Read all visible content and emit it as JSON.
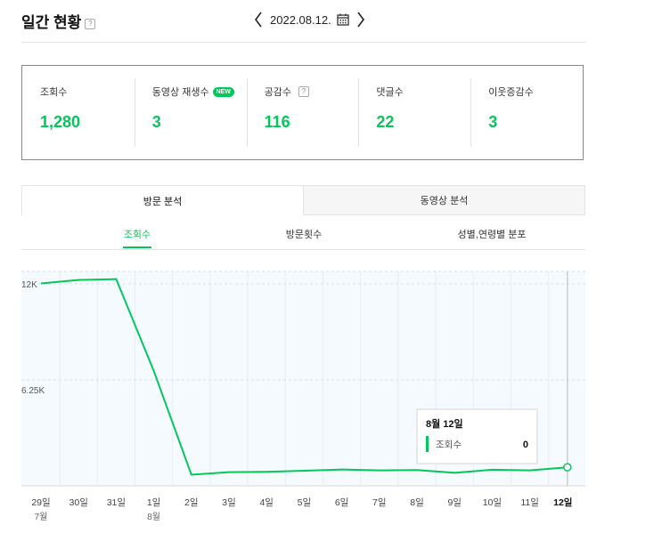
{
  "header": {
    "title": "일간 현황",
    "help": "?",
    "date": "2022.08.12."
  },
  "stats": [
    {
      "label": "조회수",
      "value": "1,280",
      "badge": "",
      "help": ""
    },
    {
      "label": "동영상 재생수",
      "value": "3",
      "badge": "NEW",
      "help": ""
    },
    {
      "label": "공감수",
      "value": "116",
      "badge": "",
      "help": "?"
    },
    {
      "label": "댓글수",
      "value": "22",
      "badge": "",
      "help": ""
    },
    {
      "label": "이웃증감수",
      "value": "3",
      "badge": "",
      "help": ""
    }
  ],
  "tabs": [
    "방문 분석",
    "동영상 분석"
  ],
  "subtabs": [
    "조회수",
    "방문횟수",
    "성별,연령별 분포"
  ],
  "colors": {
    "accent": "#03c75a",
    "chart_bg": "#f5fafe"
  },
  "chart_data": {
    "type": "line",
    "categories": [
      "29일",
      "30일",
      "31일",
      "1일",
      "2일",
      "3일",
      "4일",
      "5일",
      "6일",
      "7일",
      "8일",
      "9일",
      "10일",
      "11일",
      "12일"
    ],
    "month_labels": {
      "0": "7월",
      "3": "8월"
    },
    "series": [
      {
        "values": [
          11800,
          12000,
          12050,
          6700,
          650,
          800,
          820,
          880,
          950,
          900,
          920,
          760,
          940,
          900,
          1080
        ]
      }
    ],
    "y_ticks": [
      {
        "value": 12000,
        "label": "12K"
      },
      {
        "value": 6250,
        "label": "6.25K"
      }
    ],
    "ylim": [
      0,
      12500
    ],
    "tooltip": {
      "title": "8월 12일",
      "series_label": "조회수",
      "value": "0"
    }
  }
}
